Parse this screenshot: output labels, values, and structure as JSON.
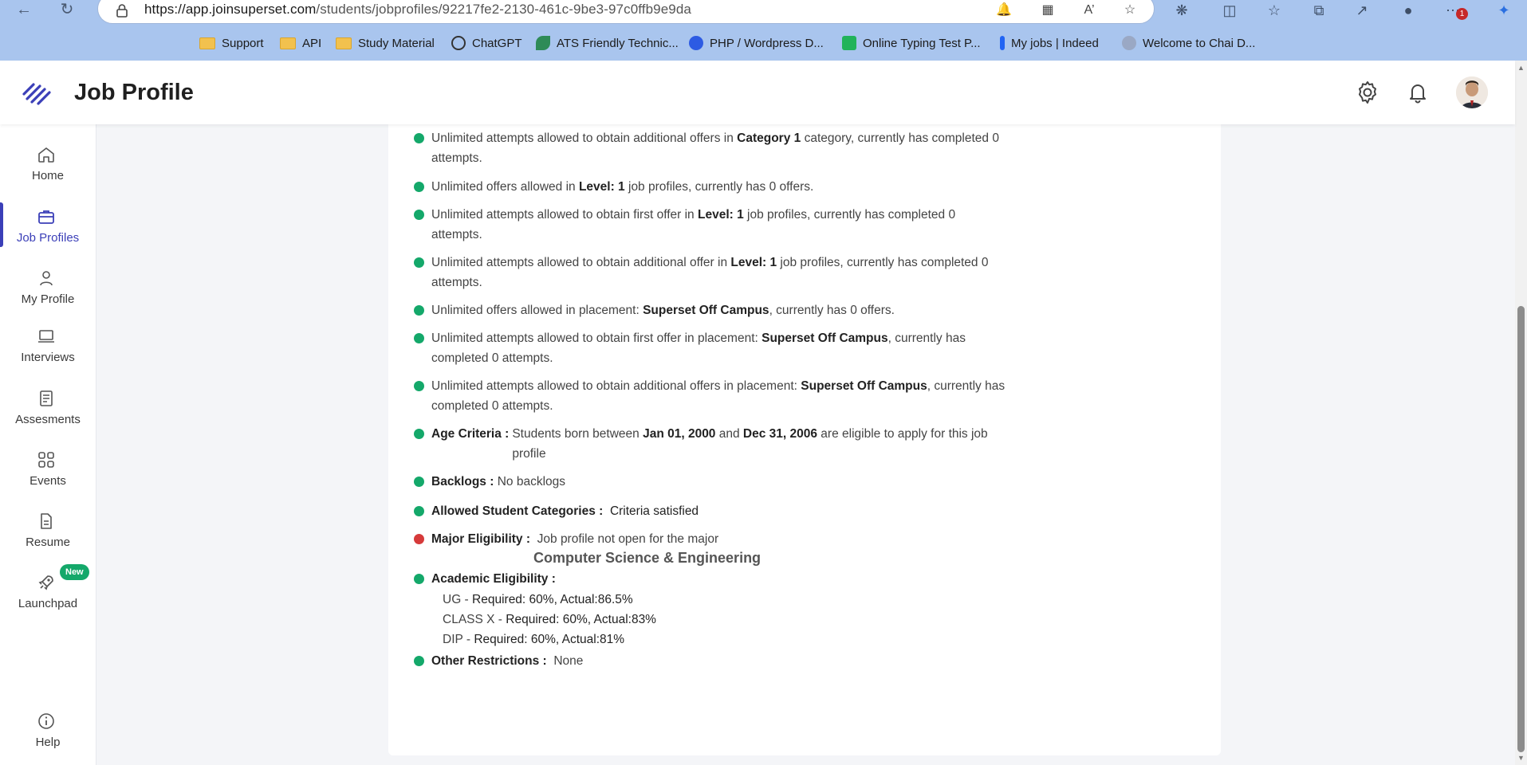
{
  "browser": {
    "url_domain": "https://app.joinsuperset.com",
    "url_path": "/students/jobprofiles/92217fe2-2130-461c-9be3-97c0ffb9e9da",
    "notification_count": "1",
    "bookmarks": [
      {
        "label": "Support",
        "icon": "folder-icon"
      },
      {
        "label": "API",
        "icon": "folder-icon"
      },
      {
        "label": "Study Material",
        "icon": "folder-icon"
      },
      {
        "label": "ChatGPT",
        "icon": "chatgpt-icon"
      },
      {
        "label": "ATS Friendly Technic...",
        "icon": "leaf-icon"
      },
      {
        "label": "PHP / Wordpress D...",
        "icon": "k-icon"
      },
      {
        "label": "Online Typing Test P...",
        "icon": "typing-icon"
      },
      {
        "label": "My jobs | Indeed",
        "icon": "indeed-icon"
      },
      {
        "label": "Welcome to Chai D...",
        "icon": "sun-icon"
      }
    ]
  },
  "header": {
    "title": "Job Profile"
  },
  "sidebar": {
    "items": [
      {
        "label": "Home",
        "icon": "home-icon"
      },
      {
        "label": "Job Profiles",
        "icon": "briefcase-icon",
        "active": true
      },
      {
        "label": "My Profile",
        "icon": "user-icon"
      },
      {
        "label": "Interviews",
        "icon": "laptop-icon"
      },
      {
        "label": "Assesments",
        "icon": "clipboard-icon"
      },
      {
        "label": "Events",
        "icon": "grid-icon"
      },
      {
        "label": "Resume",
        "icon": "document-icon"
      },
      {
        "label": "Launchpad",
        "icon": "rocket-icon",
        "badge": "New"
      },
      {
        "label": "Help",
        "icon": "info-icon"
      }
    ]
  },
  "criteria": {
    "c1": {
      "pre": "Unlimited attempts allowed to obtain additional offers in ",
      "bold": "Category 1",
      "post": " category, currently has completed 0 attempts."
    },
    "c2": {
      "pre": "Unlimited offers allowed in ",
      "bold": "Level: 1",
      "post": " job profiles, currently has 0 offers."
    },
    "c3": {
      "pre": "Unlimited attempts allowed to obtain first offer in ",
      "bold": "Level: 1",
      "post": " job profiles, currently has completed 0 attempts."
    },
    "c4": {
      "pre": "Unlimited attempts allowed to obtain additional offer in ",
      "bold": "Level: 1",
      "post": " job profiles, currently has completed 0 attempts."
    },
    "c5": {
      "pre": "Unlimited offers allowed in placement: ",
      "bold": "Superset Off Campus",
      "post": ", currently has 0 offers."
    },
    "c6": {
      "pre": "Unlimited attempts allowed to obtain first offer in placement: ",
      "bold": "Superset Off Campus",
      "post": ", currently has completed 0 attempts."
    },
    "c7": {
      "pre": "Unlimited attempts allowed to obtain additional offers in placement: ",
      "bold": "Superset Off Campus",
      "post": ", currently has completed 0 attempts."
    },
    "age": {
      "label": "Age Criteria :",
      "pre": "Students born between ",
      "from": "Jan 01, 2000",
      "mid": " and ",
      "to": "Dec 31, 2006",
      "post": " are eligible to apply for this job profile"
    },
    "backlogs": {
      "label": "Backlogs :",
      "value": "No backlogs"
    },
    "categories": {
      "label": "Allowed Student Categories :",
      "value": "Criteria satisfied"
    },
    "major": {
      "label": "Major Eligibility :",
      "value": "Job profile not open for the major",
      "major_name": "Computer Science & Engineering"
    },
    "academic": {
      "label": "Academic Eligibility :",
      "lines": [
        {
          "name": "UG",
          "text": "Required: 60%, Actual:86.5%"
        },
        {
          "name": "CLASS X",
          "text": "Required: 60%, Actual:83%"
        },
        {
          "name": "DIP",
          "text": "Required: 60%, Actual:81%"
        }
      ]
    },
    "other": {
      "label": "Other Restrictions :",
      "value": "None"
    }
  },
  "colors": {
    "accent": "#3b3fb8",
    "success": "#14a86a",
    "error": "#d63a3a"
  }
}
